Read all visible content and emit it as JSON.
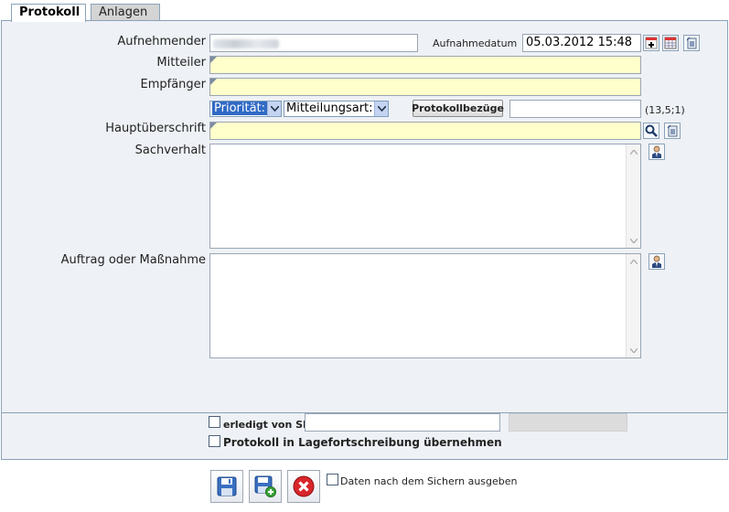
{
  "tabs": [
    {
      "label": "Protokoll",
      "active": true
    },
    {
      "label": "Anlagen",
      "active": false
    }
  ],
  "form": {
    "aufnehmender_label": "Aufnehmender",
    "aufnehmender_value": "",
    "aufnahmedatum_label": "Aufnahmedatum",
    "aufnahmedatum_value": "05.03.2012 15:48",
    "mitteiler_label": "Mitteiler",
    "empfaenger_label": "Empfänger",
    "prioritaet_select": "Priorität:",
    "mitteilungsart_select": "Mitteilungsart:",
    "protokollbezuege_button": "Protokollbezüge",
    "protokollbezuege_value": "",
    "coords_text": "(13,5;1)",
    "hauptueberschrift_label": "Hauptüberschrift",
    "sachverhalt_label": "Sachverhalt",
    "auftrag_label": "Auftrag oder Maßnahme"
  },
  "footer_panel": {
    "erledigt_label": "erledigt von SB",
    "erledigt_value": "",
    "lagefortschreibung_label": "Protokoll in Lagefortschreibung übernehmen"
  },
  "actions": {
    "save_icon": "save-icon",
    "save_new_icon": "save-new-icon",
    "cancel_icon": "cancel-icon",
    "print_after_save_label": "Daten nach dem Sichern ausgeben"
  },
  "colors": {
    "panel_bg": "#eef1f5",
    "border": "#8aa2b8",
    "required_field": "#ffffcc",
    "select_highlight": "#316ac5",
    "cancel_red": "#d8262b"
  }
}
